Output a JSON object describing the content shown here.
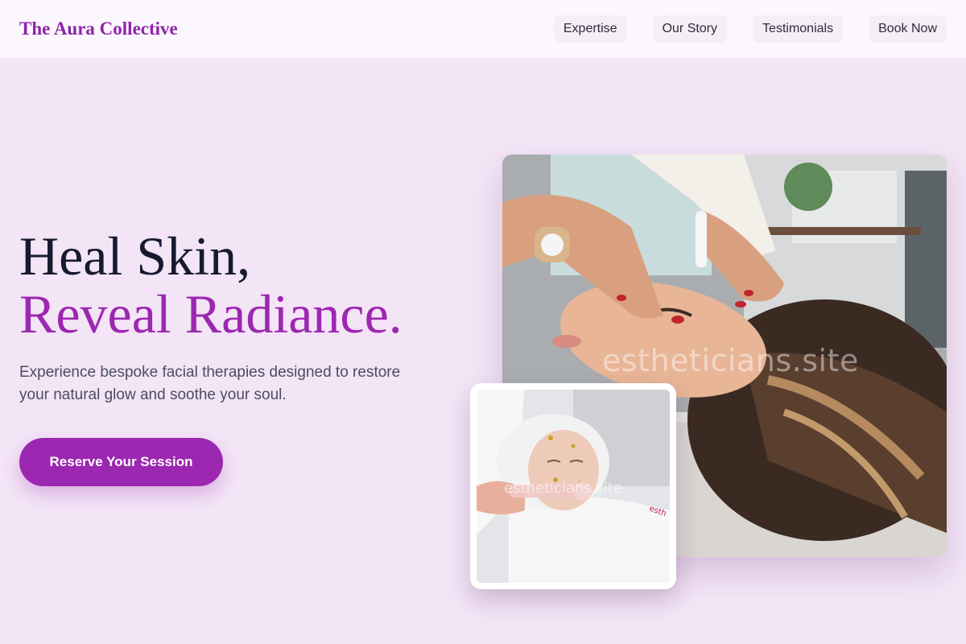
{
  "header": {
    "brand": "The Aura Collective",
    "nav": [
      "Expertise",
      "Our Story",
      "Testimonials",
      "Book Now"
    ]
  },
  "hero": {
    "title_line1": "Heal Skin,",
    "title_line2": "Reveal Radiance.",
    "subtitle": "Experience bespoke facial therapies designed to restore your natural glow and soothe your soul.",
    "cta_label": "Reserve Your Session"
  },
  "images": {
    "main_watermark": "estheticians.site",
    "inset_watermark": "estheticians.site"
  },
  "colors": {
    "accent": "#9c27b0",
    "brand": "#8e24aa",
    "background": "#f3e4f6",
    "header_bg": "#fbf7fc",
    "title_dark": "#161a2e"
  }
}
